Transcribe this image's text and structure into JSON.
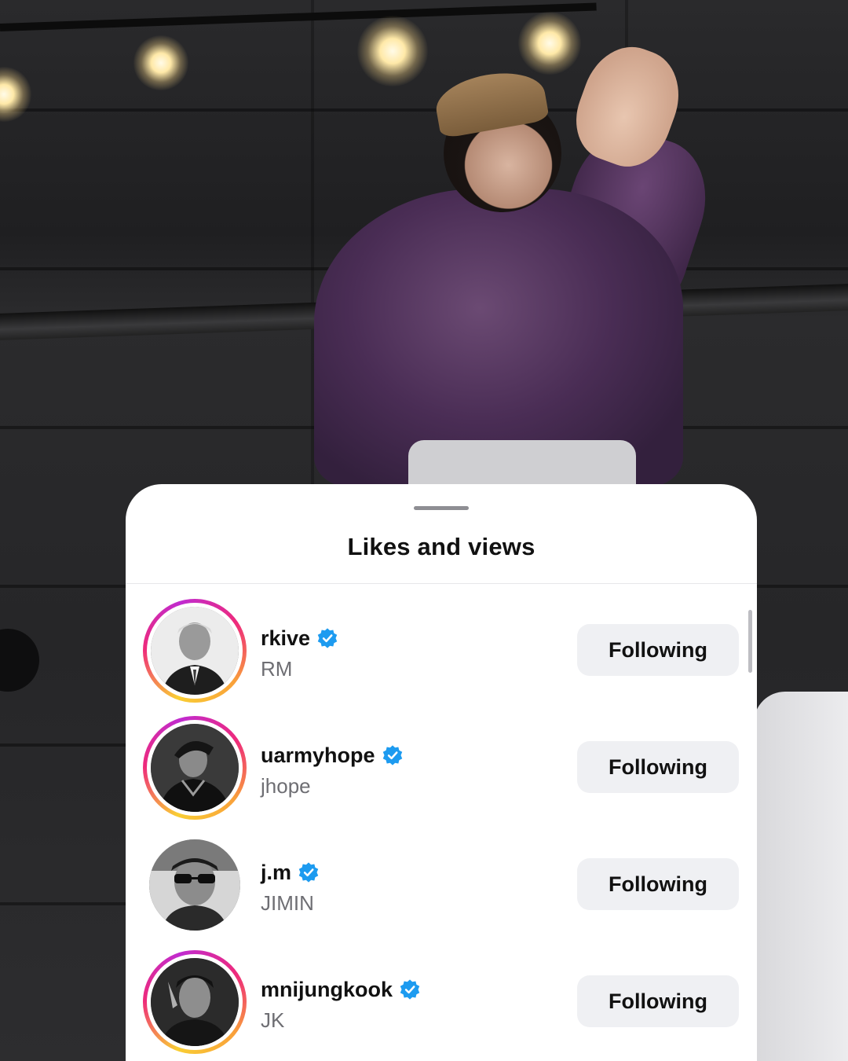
{
  "sheet": {
    "title": "Likes and views"
  },
  "users": [
    {
      "username": "rkive",
      "display_name": "RM",
      "verified": true,
      "has_story": true,
      "button_label": "Following"
    },
    {
      "username": "uarmyhope",
      "display_name": "jhope",
      "verified": true,
      "has_story": true,
      "button_label": "Following"
    },
    {
      "username": "j.m",
      "display_name": "JIMIN",
      "verified": true,
      "has_story": false,
      "button_label": "Following"
    },
    {
      "username": "mnijungkook",
      "display_name": "JK",
      "verified": true,
      "has_story": true,
      "button_label": "Following"
    }
  ],
  "colors": {
    "verified_badge": "#1d9bf0",
    "button_bg": "#eff0f3",
    "story_ring_start": "#f9ce34",
    "story_ring_mid": "#ee2a7b",
    "story_ring_end": "#c02bd0"
  },
  "icons": {
    "verified": "verified-badge-icon"
  }
}
